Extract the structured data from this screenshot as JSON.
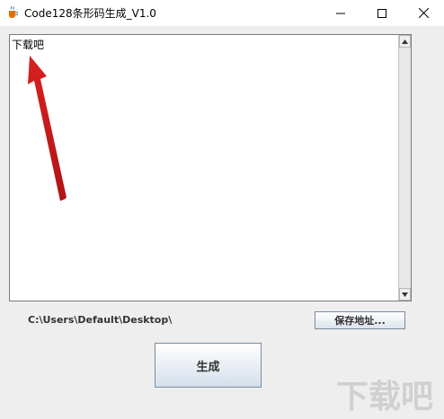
{
  "window": {
    "title": "Code128条形码生成_V1.0",
    "icon": "java-cup-icon"
  },
  "controls": {
    "minimize": "minimize-icon",
    "maximize": "maximize-icon",
    "close": "close-icon"
  },
  "editor": {
    "text": "下载吧"
  },
  "path": {
    "value": "C:\\Users\\Default\\Desktop\\"
  },
  "buttons": {
    "save_path": "保存地址...",
    "generate": "生成"
  },
  "annotation": {
    "arrow_color": "#cc1a1a"
  },
  "watermark": {
    "text": "下载吧"
  }
}
